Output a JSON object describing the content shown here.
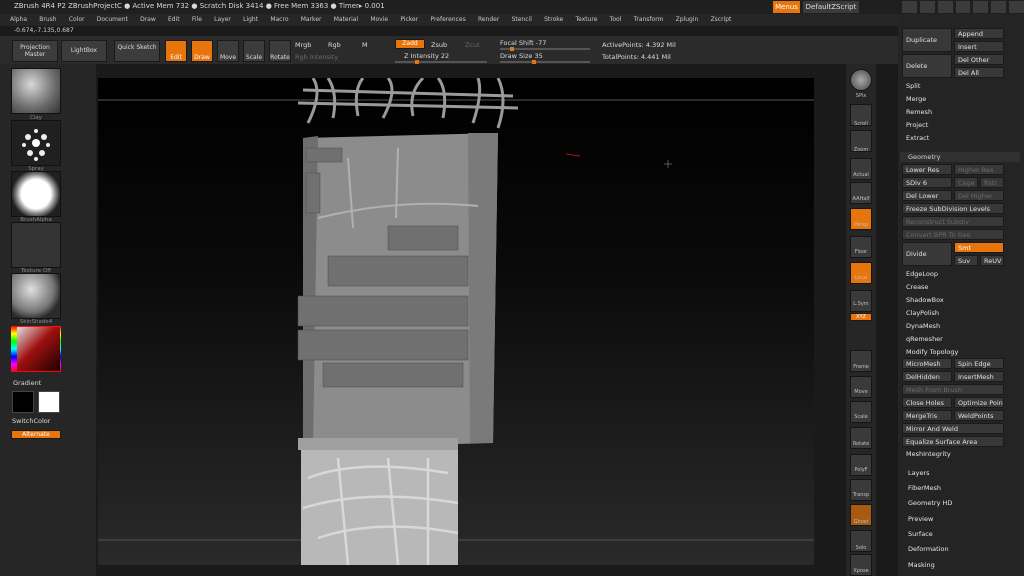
{
  "titlebar": {
    "title": "ZBrush 4R4 P2      ZBrushProjectC    ● Active Mem 732  ● Scratch Disk 3414  ● Free Mem 3363  ● Timer▸ 0.001",
    "menus": "Menus",
    "script": "DefaultZScript"
  },
  "menubar": [
    "Alpha",
    "Brush",
    "Color",
    "Document",
    "Draw",
    "Edit",
    "File",
    "Layer",
    "Light",
    "Macro",
    "Marker",
    "Material",
    "Movie",
    "Picker",
    "Preferences",
    "Render",
    "Stencil",
    "Stroke",
    "Texture",
    "Tool",
    "Transform",
    "Zplugin",
    "Zscript"
  ],
  "coords": "-0.674,-7.135,0.687",
  "toolbar": {
    "projection_master": "Projection Master",
    "lightbox": "LightBox",
    "quick_sketch": "Quick Sketch",
    "edit": "Edit",
    "draw": "Draw",
    "move": "Move",
    "scale": "Scale",
    "rotate": "Rotate",
    "mrgb": "Mrgb",
    "rgb": "Rgb",
    "m": "M",
    "rgb_intensity": "Rgb Intensity",
    "zadd": "Zadd",
    "zsub": "Zsub",
    "zcut": "Zcut",
    "z_intensity": "Z Intensity 22",
    "focal_shift": "Focal Shift -77",
    "draw_size": "Draw Size 35",
    "active_points": "ActivePoints: 4.392 Mil",
    "total_points": "TotalPoints: 4.441 Mil"
  },
  "left_shelf": {
    "brush_label": "Clay",
    "stroke_label": "Spray",
    "alpha_label": "BrushAlpha",
    "texture_label": "Texture Off",
    "material_label": "SkinShade4",
    "gradient": "Gradient",
    "switch_color": "SwitchColor",
    "alternate": "Alternate"
  },
  "right_shelf": [
    "SPix",
    "Scroll",
    "Zoom",
    "Actual",
    "AAHalf",
    "Persp",
    "Floor",
    "Local",
    "L.Sym",
    "XYZ",
    "Frame",
    "Move",
    "Scale",
    "Rotate",
    "PolyF",
    "Transp",
    "Ghost",
    "Solo",
    "Xpose"
  ],
  "right_panel": {
    "duplicate": "Duplicate",
    "append": "Append",
    "insert": "Insert",
    "delete": "Delete",
    "del_other": "Del Other",
    "del_all": "Del All",
    "split": "Split",
    "merge": "Merge",
    "remesh": "Remesh",
    "project": "Project",
    "extract": "Extract",
    "geometry": "Geometry",
    "lower_res": "Lower Res",
    "higher_res": "Higher Res",
    "sdiv": "SDiv 6",
    "cage": "Cage",
    "rstr": "Rstr",
    "del_lower": "Del Lower",
    "del_higher": "Del Higher",
    "freeze": "Freeze SubDivision Levels",
    "reconstruct": "Reconstruct Subdiv",
    "convert_bpr": "Convert BPR To Geo",
    "divide": "Divide",
    "smt": "Smt",
    "suv": "Suv",
    "reuv": "ReUV",
    "edgeloop": "EdgeLoop",
    "crease": "Crease",
    "shadowbox": "ShadowBox",
    "claypolish": "ClayPolish",
    "dynamesh": "DynaMesh",
    "qremesher": "qRemesher",
    "modify_topology": "Modify Topology",
    "micromesh": "MicroMesh",
    "spin_edge": "Spin Edge",
    "delhidden": "DelHidden",
    "insertmesh": "InsertMesh",
    "mesh_from_brush": "Mesh From Brush",
    "close_holes": "Close Holes",
    "optimize_points": "Optimize Points",
    "mergetris": "MergeTris",
    "weldpoints": "WeldPoints",
    "mirror_and_weld": "Mirror And Weld",
    "equalize": "Equalize Surface Area",
    "meshintegrity": "MeshIntegrity",
    "sections": [
      "Layers",
      "FiberMesh",
      "Geometry HD",
      "Preview",
      "Surface",
      "Deformation",
      "Masking"
    ]
  },
  "colors": {
    "accent": "#e8740c",
    "panel": "#242424",
    "button": "#383838"
  }
}
